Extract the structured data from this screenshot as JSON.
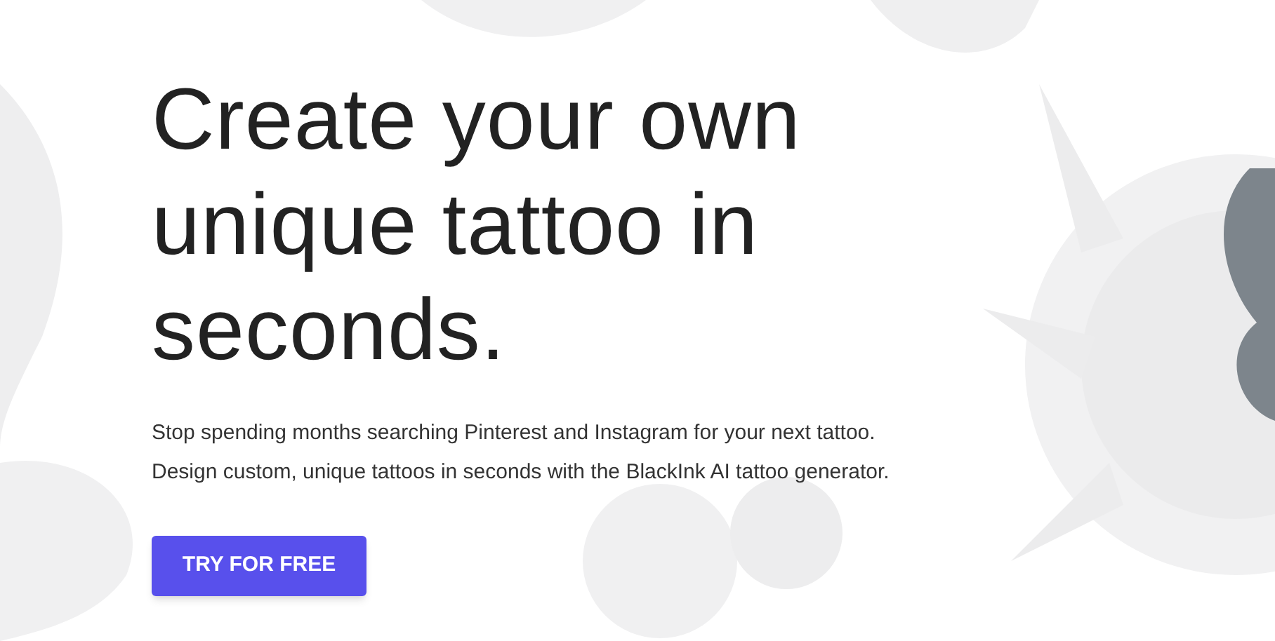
{
  "hero": {
    "title": "Create your own unique tattoo in seconds.",
    "description": [
      "Stop spending months searching Pinterest and Instagram for your next tattoo.",
      "Design custom, unique tattoos in seconds with the BlackInk AI tattoo generator."
    ],
    "cta_button": "TRY FOR FREE"
  }
}
